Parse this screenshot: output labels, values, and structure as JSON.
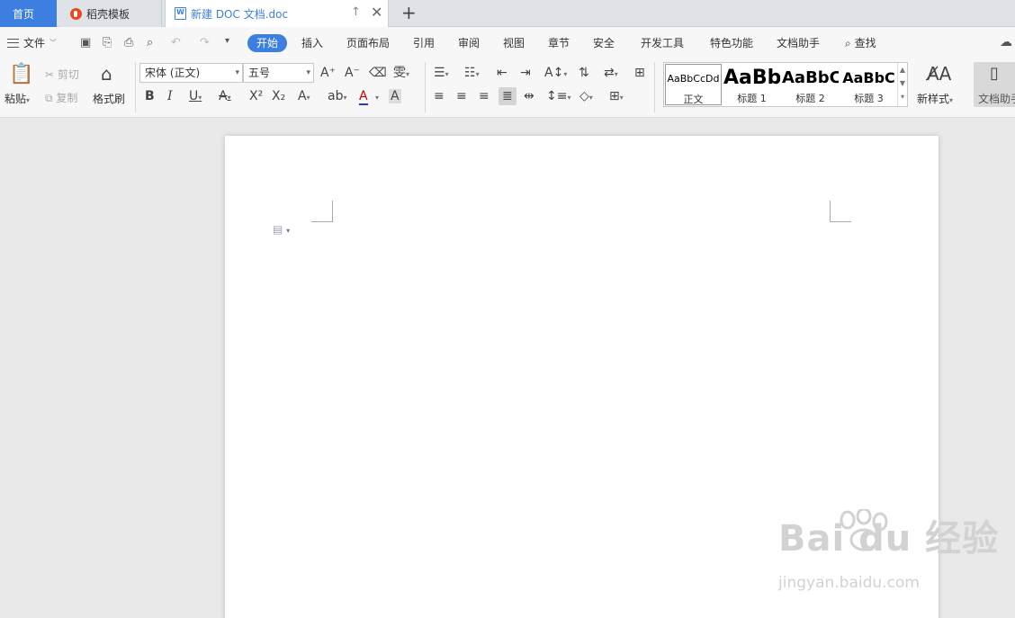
{
  "tabs": {
    "home": "首页",
    "template": "稻壳模板",
    "document": "新建 DOC 文档.doc",
    "doc_icon": "W"
  },
  "menu": {
    "file": "文件",
    "items": [
      "开始",
      "插入",
      "页面布局",
      "引用",
      "审阅",
      "视图",
      "章节",
      "安全",
      "开发工具",
      "特色功能",
      "文档助手",
      "查找"
    ]
  },
  "ribbon": {
    "paste": "粘贴",
    "cut": "剪切",
    "copy": "复制",
    "format_painter": "格式刷",
    "font_name": "宋体 (正文)",
    "font_size": "五号",
    "styles": [
      {
        "sample": "AaBbCcDd",
        "label": "正文"
      },
      {
        "sample": "AaBb",
        "label": "标题 1"
      },
      {
        "sample": "AaBbC",
        "label": "标题 2"
      },
      {
        "sample": "AaBbC",
        "label": "标题 3"
      }
    ],
    "new_style": "新样式",
    "doc_assistant": "文档助手"
  },
  "watermark": {
    "brand": "Bai  du 经验",
    "url": "jingyan.baidu.com"
  },
  "colors": {
    "accent": "#3d7fe0",
    "brand_flame": "#e8491d"
  }
}
